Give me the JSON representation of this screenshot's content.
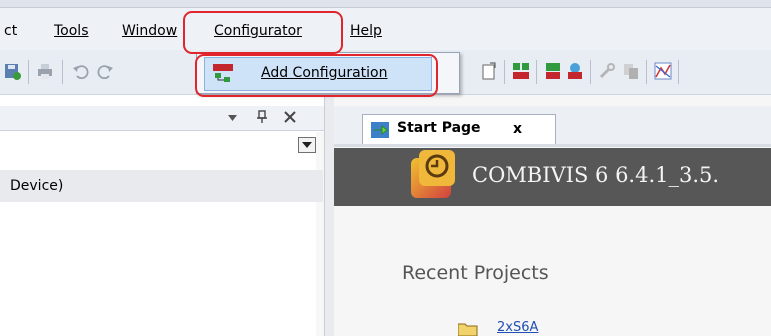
{
  "menubar": {
    "items": [
      {
        "label": "ct"
      },
      {
        "label": "Tools"
      },
      {
        "label": "Window"
      },
      {
        "label": "Configurator"
      },
      {
        "label": "Help"
      }
    ]
  },
  "dropdown": {
    "items": [
      {
        "label": "Add Configuration",
        "icon": "keb-configuration-icon"
      }
    ]
  },
  "left_panel": {
    "header_controls": [
      "dropdown-arrow-icon",
      "pin-icon",
      "close-icon"
    ],
    "tree_item": "Device)"
  },
  "document": {
    "tab_label": "Start Page",
    "tab_close": "x",
    "banner_title": "COMBIVIS 6 6.4.1_3.5.",
    "recent_projects_heading": "Recent Projects",
    "recent_project_item": "2xS6A"
  },
  "colors": {
    "annotation_red": "#e0252c",
    "banner_bg": "#575757",
    "highlight_blue": "#cfe3f8"
  }
}
